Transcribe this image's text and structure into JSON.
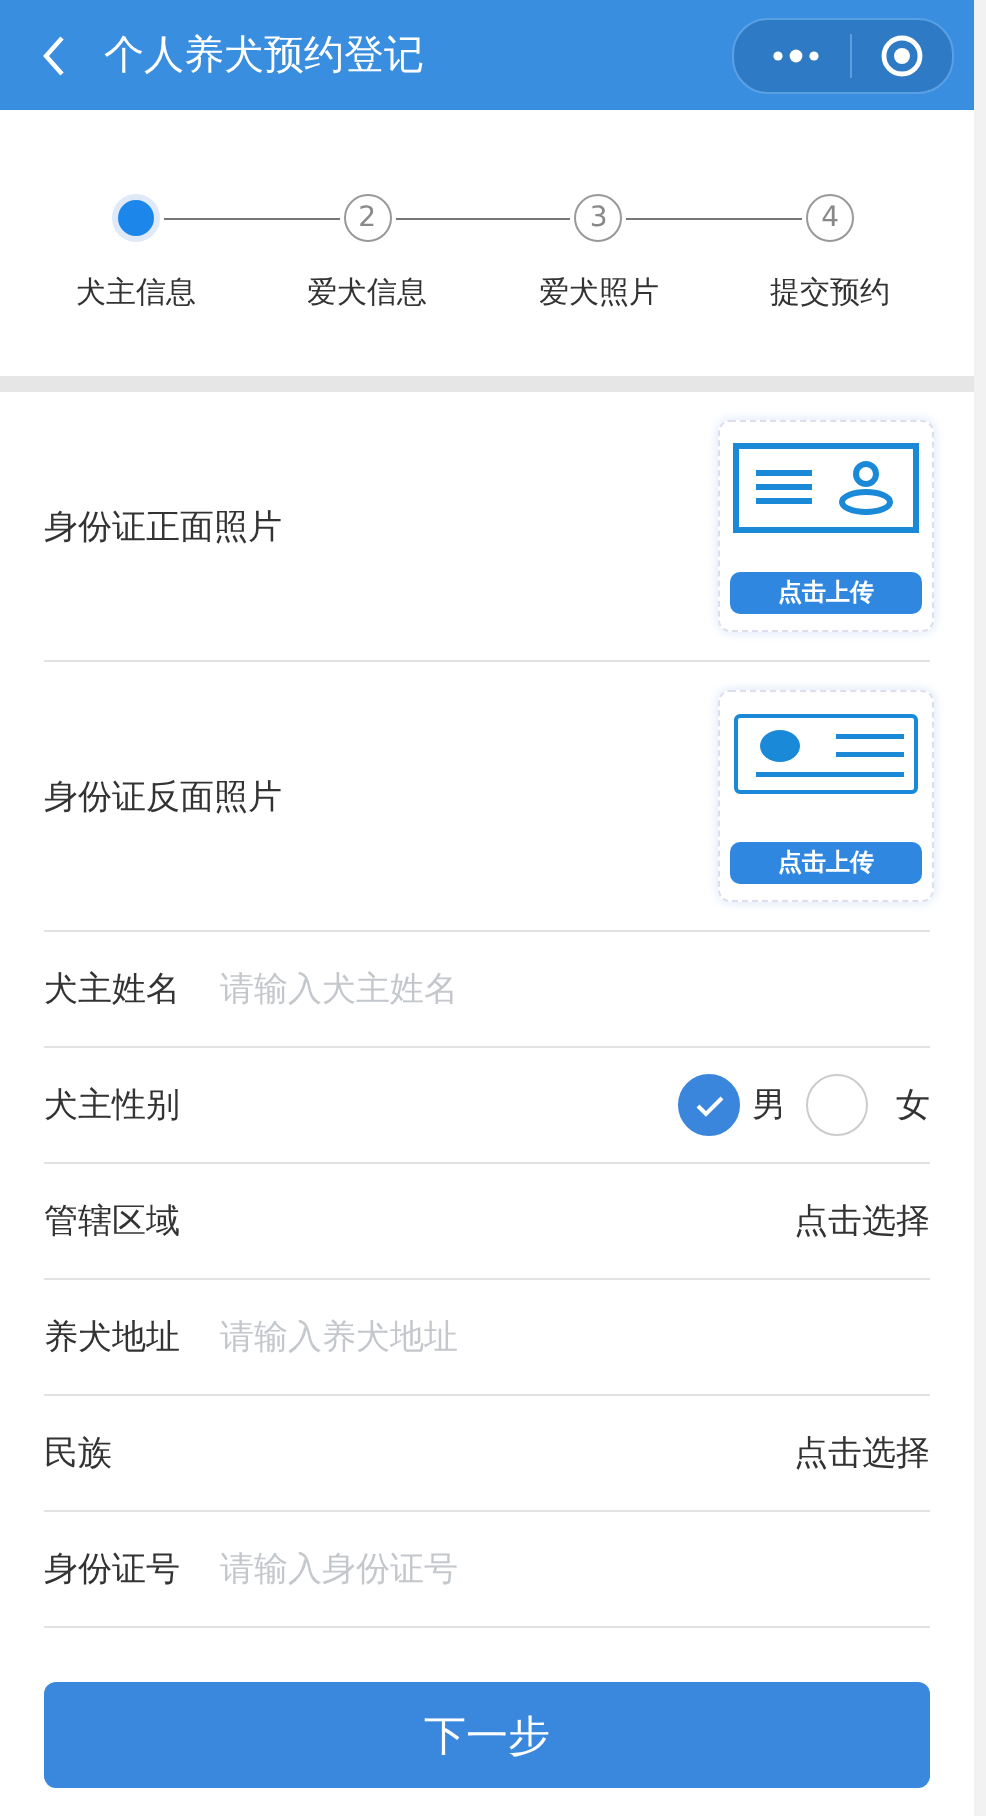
{
  "nav": {
    "title": "个人养犬预约登记"
  },
  "steps": [
    {
      "label": "犬主信息",
      "selected": true
    },
    {
      "number": "2",
      "label": "爱犬信息",
      "selected": false
    },
    {
      "number": "3",
      "label": "爱犬照片",
      "selected": false
    },
    {
      "number": "4",
      "label": "提交预约",
      "selected": false
    }
  ],
  "uploads": [
    {
      "kind": "front",
      "label": "身份证正面照片",
      "button": "点击上传"
    },
    {
      "kind": "back",
      "label": "身份证反面照片",
      "button": "点击上传"
    }
  ],
  "fields": [
    {
      "kind": "input",
      "label": "犬主姓名",
      "placeholder": "请输入犬主姓名"
    },
    {
      "kind": "radio",
      "label": "犬主性别",
      "options": [
        {
          "label": "男",
          "selected": true
        },
        {
          "label": "女",
          "selected": false
        }
      ]
    },
    {
      "kind": "select",
      "label": "管辖区域",
      "value": "点击选择"
    },
    {
      "kind": "input",
      "label": "养犬地址",
      "placeholder": "请输入养犬地址"
    },
    {
      "kind": "select",
      "label": "民族",
      "value": "点击选择"
    },
    {
      "kind": "input",
      "label": "身份证号",
      "placeholder": "请输入身份证号"
    }
  ],
  "next_button": "下一步"
}
